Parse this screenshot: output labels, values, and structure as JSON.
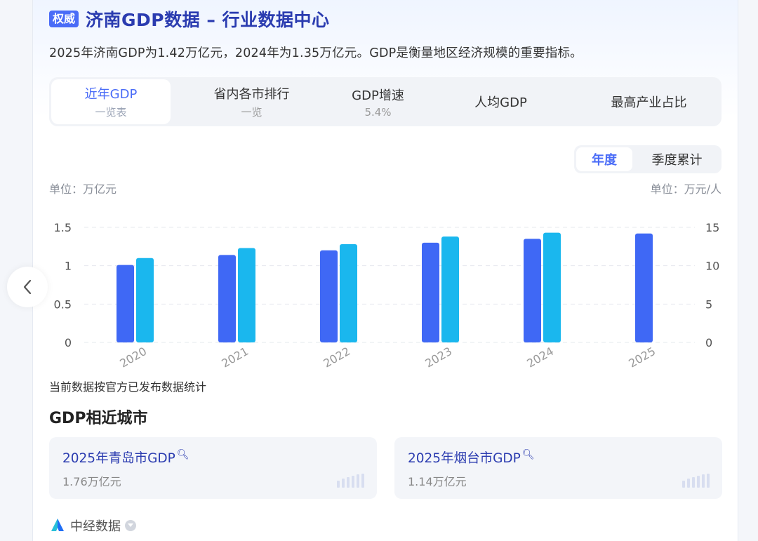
{
  "header": {
    "badge": "权威",
    "title": "济南GDP数据 – 行业数据中心",
    "summary": "2025年济南GDP为1.42万亿元，2024年为1.35万亿元。GDP是衡量地区经济规模的重要指标。"
  },
  "tabs": [
    {
      "label": "近年GDP",
      "sub": "一览表",
      "active": true
    },
    {
      "label": "省内各市排行",
      "sub": "一览"
    },
    {
      "label": "GDP增速",
      "sub": "5.4%"
    },
    {
      "label": "人均GDP",
      "sub": ""
    },
    {
      "label": "最高产业占比",
      "sub": ""
    }
  ],
  "period": {
    "annual": "年度",
    "quarterly": "季度累计"
  },
  "units": {
    "left": "单位：万亿元",
    "right": "单位：万元/人"
  },
  "chart_data": {
    "type": "bar",
    "categories": [
      "2020",
      "2021",
      "2022",
      "2023",
      "2024",
      "2025"
    ],
    "series": [
      {
        "values": [
          1.01,
          1.14,
          1.2,
          1.3,
          1.35,
          1.42
        ],
        "color": "#3f68f5",
        "axis": "left"
      },
      {
        "values": [
          11.0,
          12.3,
          12.8,
          13.8,
          14.3,
          null
        ],
        "color": "#1ab7ee",
        "axis": "right"
      }
    ],
    "y_left": {
      "range": [
        0,
        1.5
      ],
      "ticks": [
        "0",
        "0.5",
        "1",
        "1.5"
      ]
    },
    "y_right": {
      "range": [
        0,
        15
      ],
      "ticks": [
        "0",
        "5",
        "10",
        "15"
      ]
    },
    "grid": true
  },
  "chart_note": "当前数据按官方已发布数据统计",
  "similar": {
    "title": "GDP相近城市",
    "cities": [
      {
        "name": "2025年青岛市GDP",
        "value": "1.76万亿元"
      },
      {
        "name": "2025年烟台市GDP",
        "value": "1.14万亿元"
      }
    ]
  },
  "footer": {
    "source": "中经数据"
  },
  "colors": {
    "accent": "#4a6cf7",
    "title": "#2b3cb0",
    "bar_primary": "#3f68f5",
    "bar_secondary": "#1ab7ee"
  }
}
